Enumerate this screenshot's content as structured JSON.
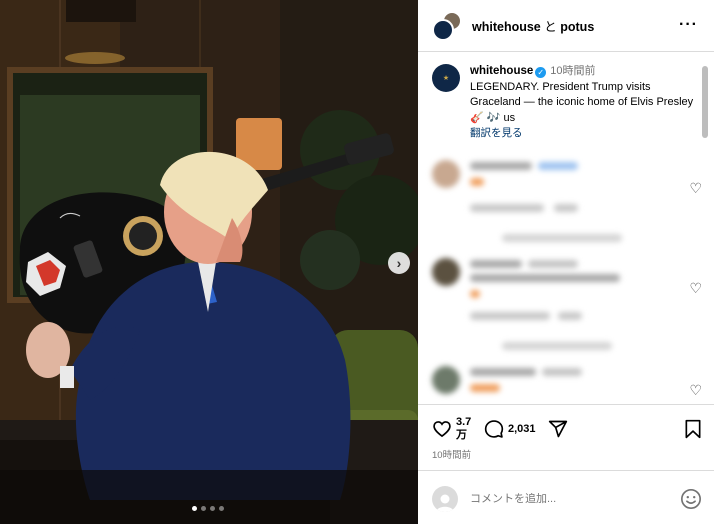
{
  "header": {
    "user1": "whitehouse",
    "connector": "と",
    "user2": "potus",
    "more_icon": "more-horizontal-icon"
  },
  "caption": {
    "username": "whitehouse",
    "time": "10時間前",
    "text": "LEGENDARY. President Trump visits Graceland — the iconic home of Elvis Presley 🎸 🎶 us",
    "translate": "翻訳を見る"
  },
  "actions": {
    "likes_line1": "3.7",
    "likes_line2": "万",
    "comments_count": "2,031",
    "icons": [
      "heart-icon",
      "comment-icon",
      "share-icon",
      "bookmark-icon"
    ]
  },
  "footer": {
    "time": "10時間前",
    "comment_placeholder": "コメントを追加..."
  },
  "photo": {
    "image_count": 4,
    "active_index": 0
  }
}
